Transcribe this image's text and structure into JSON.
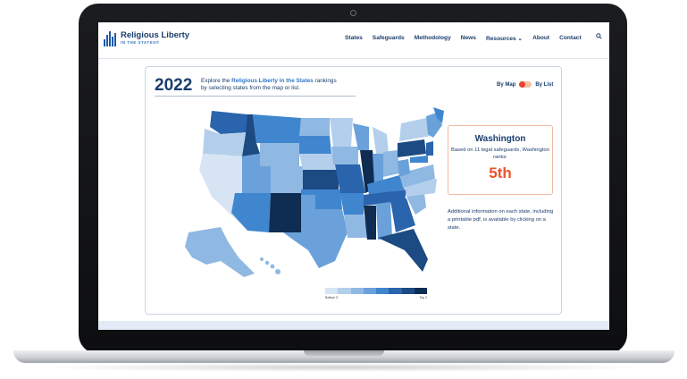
{
  "logo": {
    "title": "Religious Liberty",
    "subtitle": "IN THE STATES®"
  },
  "nav": [
    {
      "label": "States"
    },
    {
      "label": "Safeguards"
    },
    {
      "label": "Methodology"
    },
    {
      "label": "News"
    },
    {
      "label": "Resources ⌄"
    },
    {
      "label": "About"
    },
    {
      "label": "Contact"
    }
  ],
  "icons": {
    "search": "search-icon"
  },
  "intro": {
    "year": "2022",
    "text_before": "Explore the ",
    "highlight": "Religious Liberty in the States",
    "text_after": " rankings by selecting states from the map or list."
  },
  "toggle": {
    "by_map": "By Map",
    "by_list": "By List",
    "selected": "By Map"
  },
  "legend": {
    "colors": [
      "#d6e4f4",
      "#b4cfec",
      "#8fb8e3",
      "#6aa1da",
      "#3f86cf",
      "#2a64ad",
      "#1c4a82",
      "#0f2c52"
    ],
    "bottom_label": "Bottom 3",
    "top_label": "Top 2"
  },
  "info": {
    "state": "Washington",
    "based_on": "Based on 11 legal safeguards, Washington ranks:",
    "rank": "5th"
  },
  "additional": "Additional information on each state, including a printable pdf, is available by clicking on a state.",
  "colors": {
    "accent": "#e8452c",
    "brand": "#1a3d6d",
    "link": "#2f77c8"
  }
}
